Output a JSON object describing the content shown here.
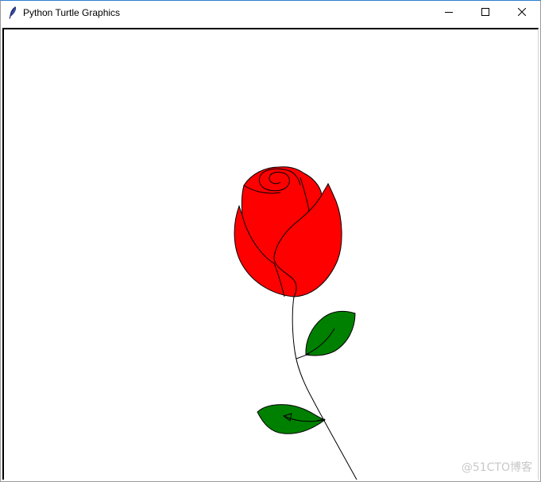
{
  "window": {
    "title": "Python Turtle Graphics",
    "app_icon": "feather-icon",
    "controls": [
      {
        "name": "minimize",
        "icon": "minimize-icon"
      },
      {
        "name": "maximize",
        "icon": "maximize-icon"
      },
      {
        "name": "close",
        "icon": "close-icon"
      }
    ]
  },
  "drawing": {
    "subject": "rose",
    "colors": {
      "petal_fill": "#ff0000",
      "leaf_fill": "#008000",
      "outline": "#000000",
      "background": "#ffffff"
    }
  },
  "watermark": {
    "text": "@51CTO博客"
  }
}
